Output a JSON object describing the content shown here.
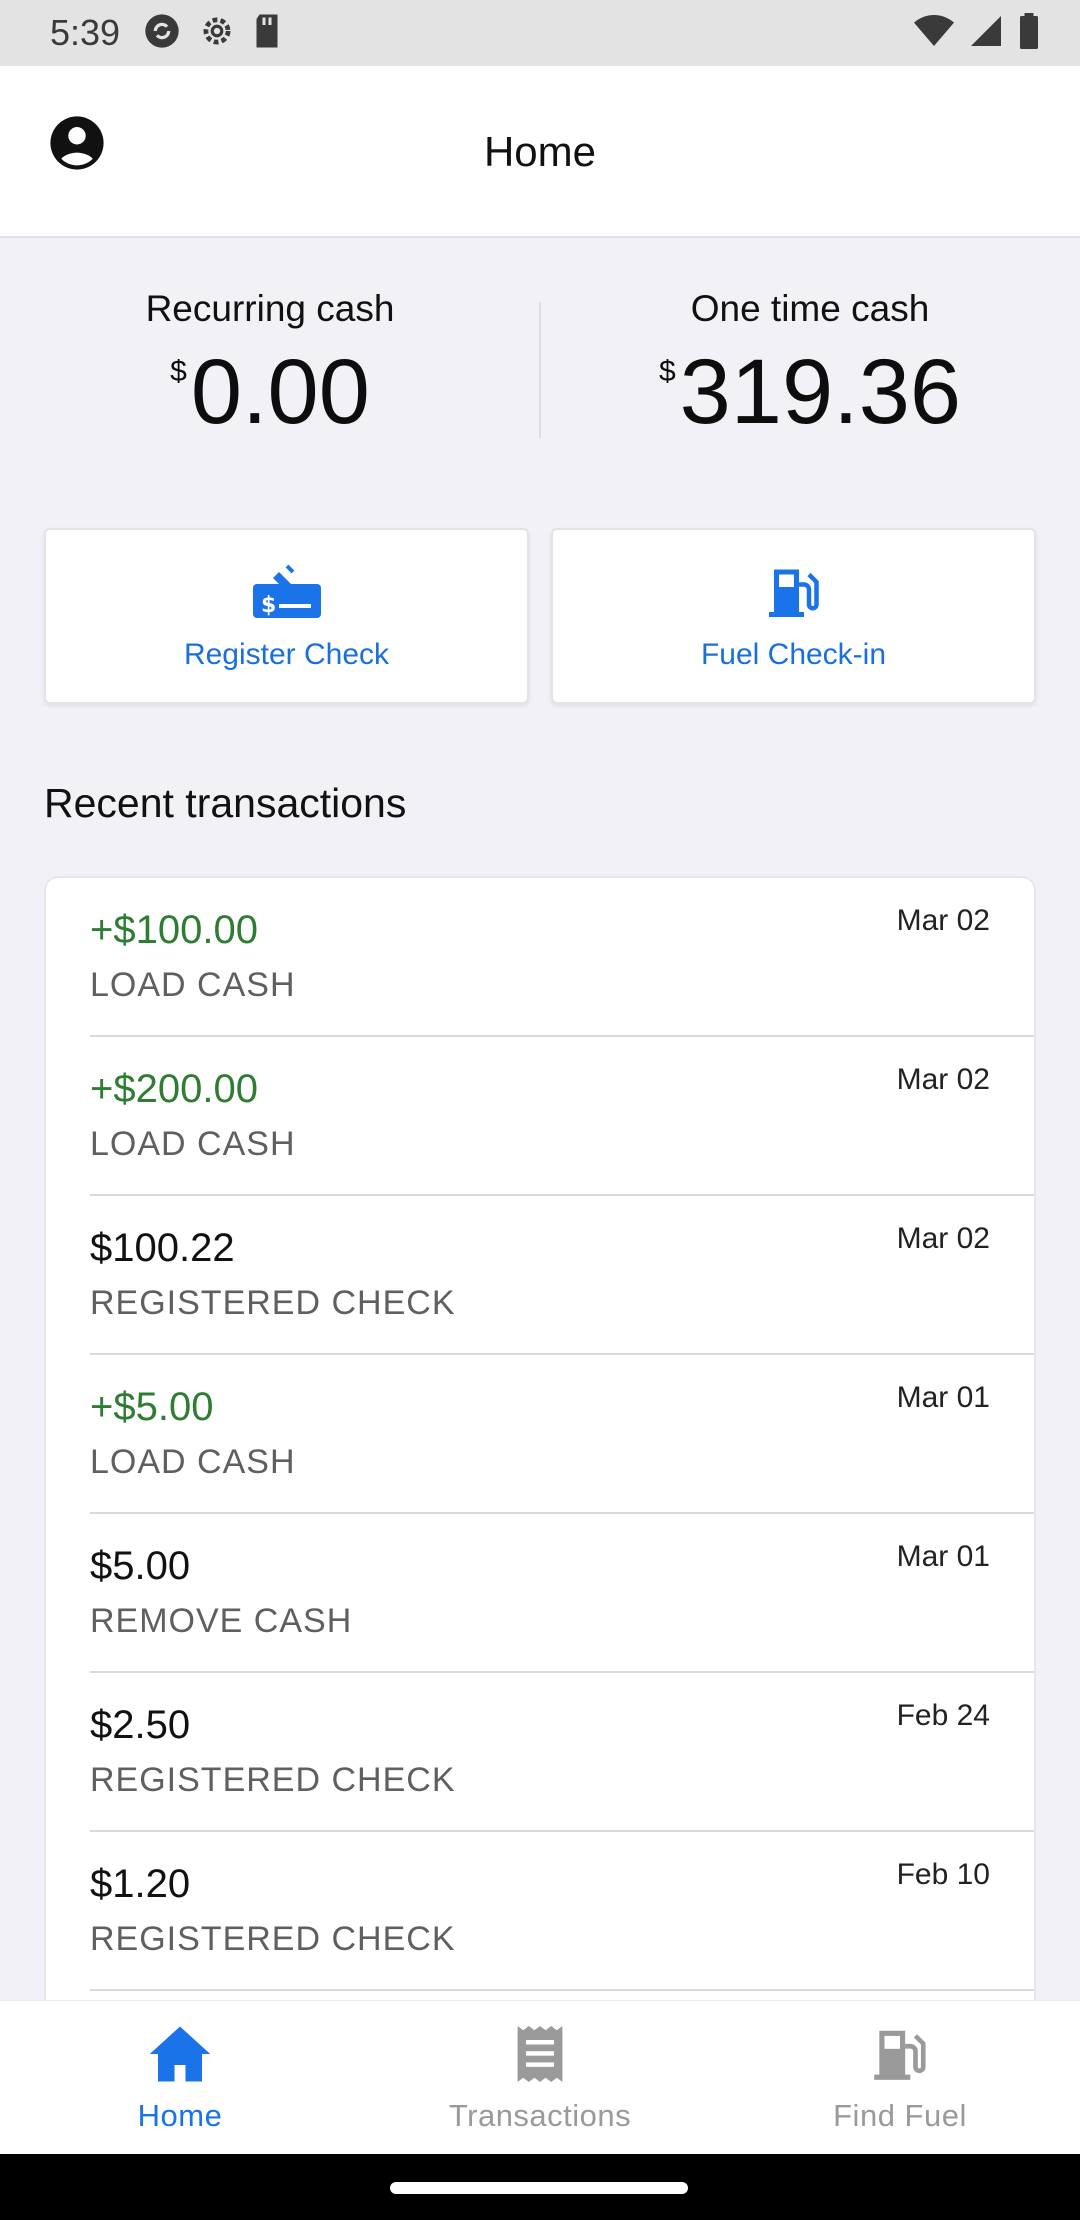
{
  "status_bar": {
    "time": "5:39",
    "icons": [
      "sync-icon",
      "settings-icon",
      "sd-card-icon",
      "wifi-icon",
      "signal-icon",
      "battery-icon"
    ]
  },
  "header": {
    "title": "Home",
    "account_icon": "account-circle-icon"
  },
  "balances": {
    "recurring": {
      "label": "Recurring cash",
      "currency": "$",
      "amount": "0.00"
    },
    "one_time": {
      "label": "One time cash",
      "currency": "$",
      "amount": "319.36"
    }
  },
  "actions": [
    {
      "label": "Register Check",
      "icon": "check-icon"
    },
    {
      "label": "Fuel Check-in",
      "icon": "fuel-pump-icon"
    }
  ],
  "recent": {
    "title": "Recent transactions",
    "transactions": [
      {
        "amount": "+$100.00",
        "type": "LOAD CASH",
        "date": "Mar 02",
        "credit": true
      },
      {
        "amount": "+$200.00",
        "type": "LOAD CASH",
        "date": "Mar 02",
        "credit": true
      },
      {
        "amount": "$100.22",
        "type": "REGISTERED CHECK",
        "date": "Mar 02",
        "credit": false
      },
      {
        "amount": "+$5.00",
        "type": "LOAD CASH",
        "date": "Mar 01",
        "credit": true
      },
      {
        "amount": "$5.00",
        "type": "REMOVE CASH",
        "date": "Mar 01",
        "credit": false
      },
      {
        "amount": "$2.50",
        "type": "REGISTERED CHECK",
        "date": "Feb 24",
        "credit": false
      },
      {
        "amount": "$1.20",
        "type": "REGISTERED CHECK",
        "date": "Feb 10",
        "credit": false
      }
    ]
  },
  "nav": {
    "items": [
      {
        "label": "Home",
        "icon": "home-icon",
        "active": true
      },
      {
        "label": "Transactions",
        "icon": "receipt-icon",
        "active": false
      },
      {
        "label": "Find Fuel",
        "icon": "fuel-station-icon",
        "active": false
      }
    ]
  },
  "colors": {
    "accent": "#1a73e8",
    "credit": "#2e7d32",
    "background": "#f1f1f6"
  }
}
